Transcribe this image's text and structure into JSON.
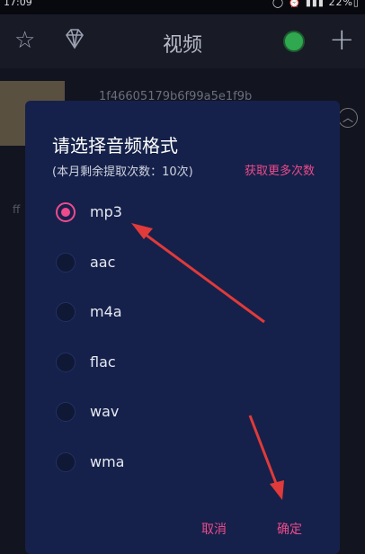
{
  "status_bar": {
    "time": "17:09",
    "right_text": "◯ ⏰ ▮▮▮ 22%▯"
  },
  "app_bar": {
    "title": "视频",
    "icons": [
      "star-icon",
      "diamond-icon",
      "avatar",
      "plus-icon"
    ]
  },
  "background": {
    "filename": "1f46605179b6f99a5e1f9b",
    "side_label": "ff"
  },
  "dialog": {
    "title": "请选择音频格式",
    "quota_text": "(本月剩余提取次数：10次)",
    "more_link": "获取更多次数",
    "options": [
      {
        "label": "mp3",
        "selected": true
      },
      {
        "label": "aac",
        "selected": false
      },
      {
        "label": "m4a",
        "selected": false
      },
      {
        "label": "flac",
        "selected": false
      },
      {
        "label": "wav",
        "selected": false
      },
      {
        "label": "wma",
        "selected": false
      }
    ],
    "cancel_label": "取消",
    "ok_label": "确定"
  },
  "colors": {
    "accent": "#ec4a8a",
    "dialog_bg": "#15214a",
    "annotation_arrow": "#e03a3a"
  }
}
